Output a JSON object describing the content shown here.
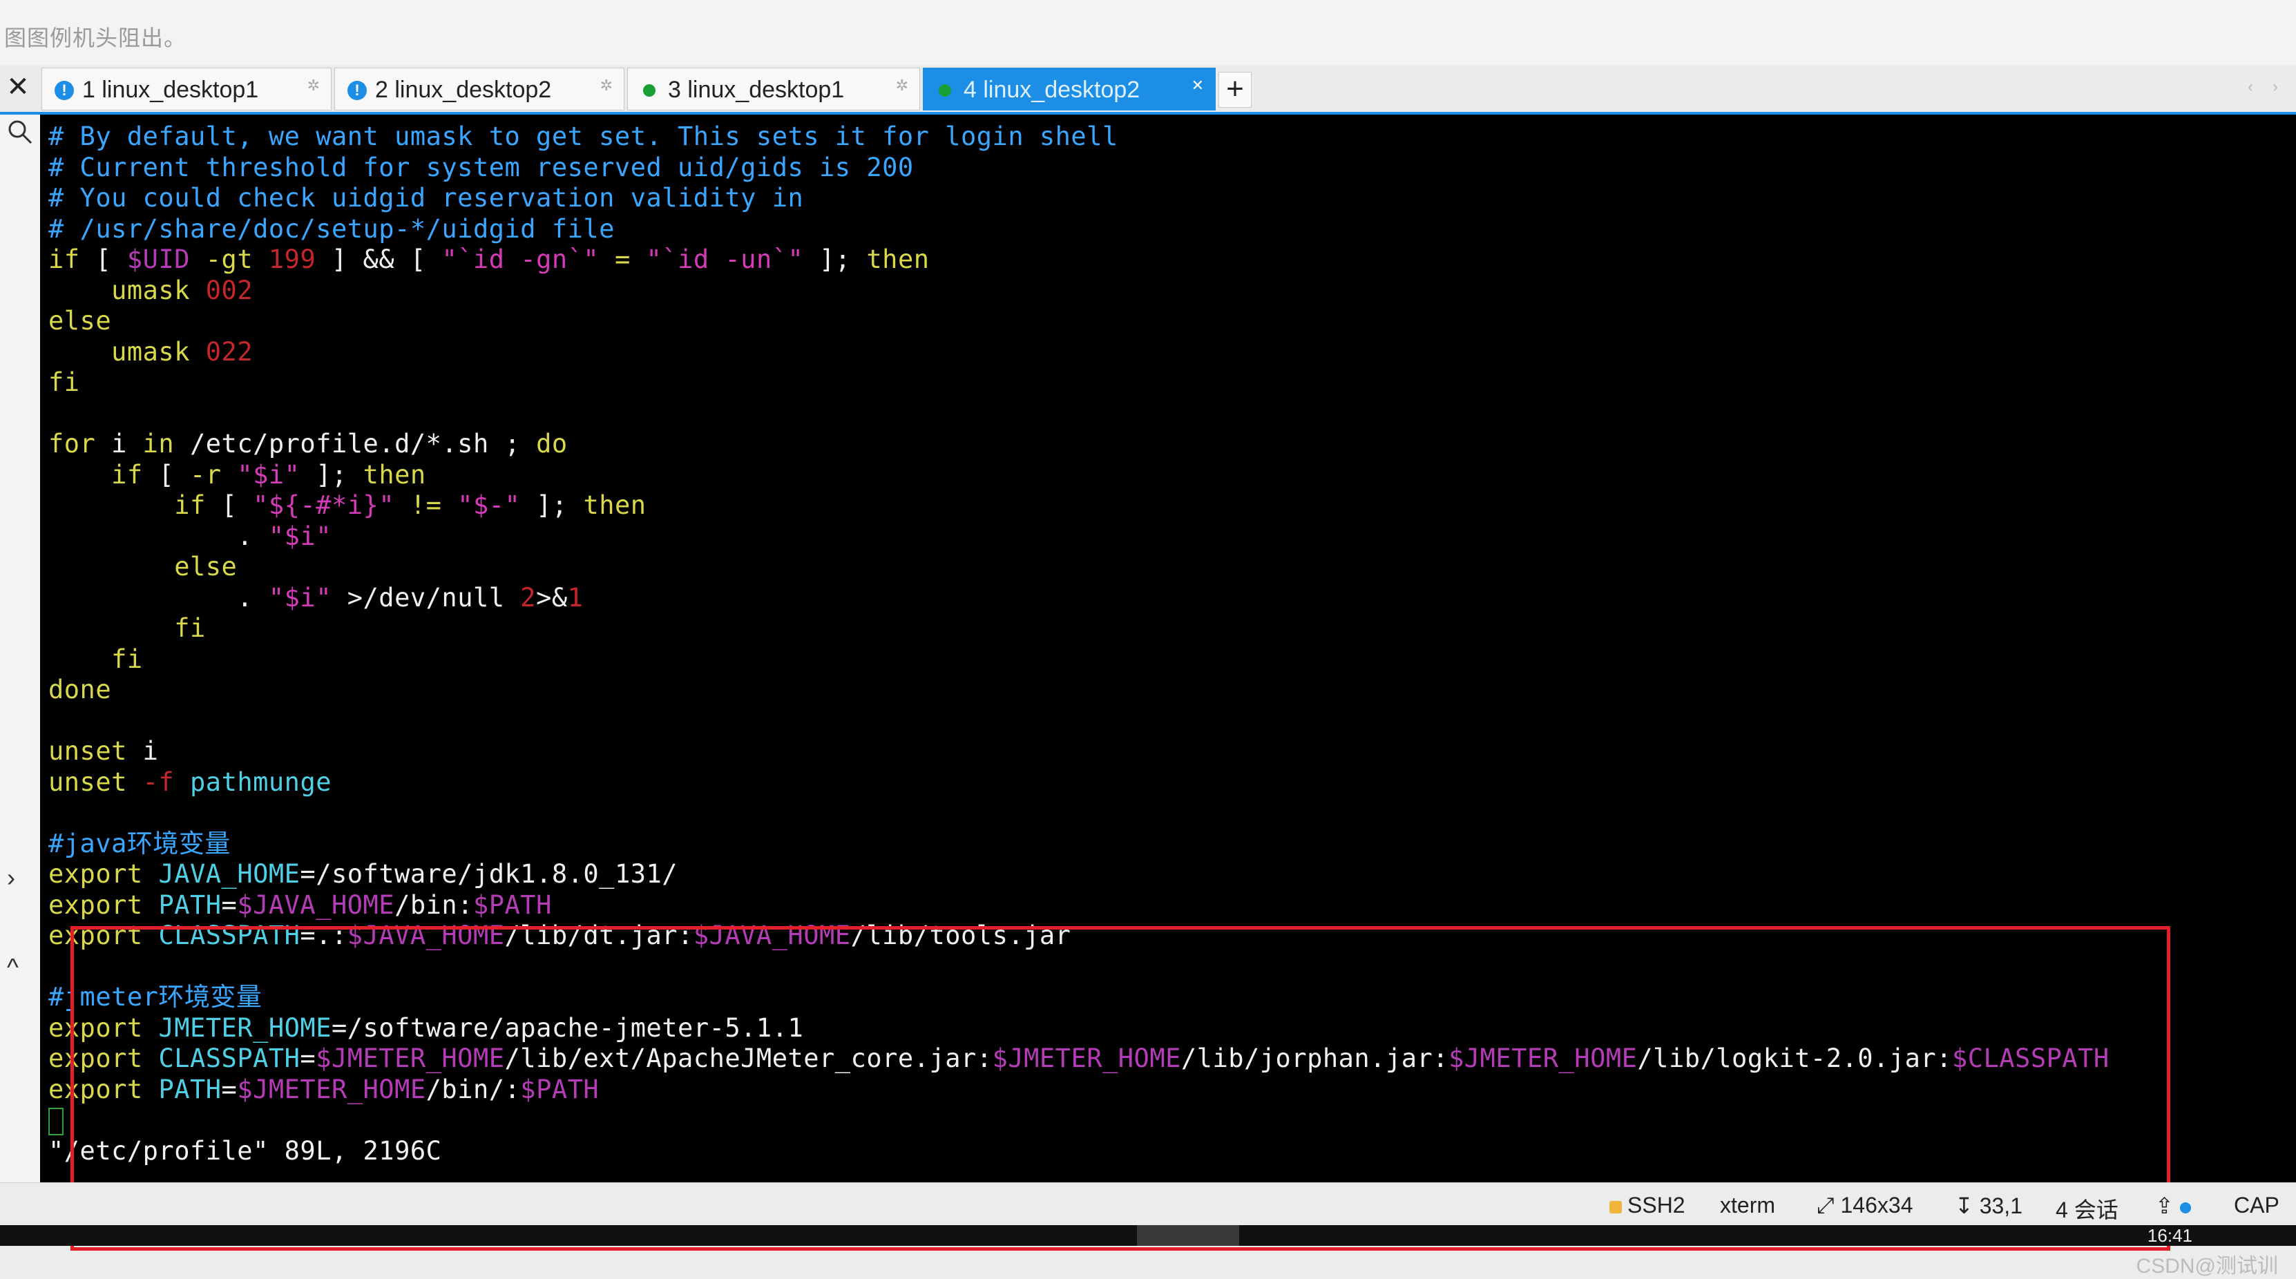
{
  "window": {
    "title": "图图例机头阻出。"
  },
  "tabs": [
    {
      "label": "1 linux_desktop1",
      "status_color": "#1d8ee6",
      "icon": "alert-icon",
      "active": false
    },
    {
      "label": "2 linux_desktop2",
      "status_color": "#1d8ee6",
      "icon": "alert-icon",
      "active": false
    },
    {
      "label": "3 linux_desktop1",
      "status_color": "#18a035",
      "icon": "connected-dot-icon",
      "active": false
    },
    {
      "label": "4 linux_desktop2",
      "status_color": "#18a035",
      "icon": "connected-dot-icon",
      "active": true
    }
  ],
  "tab_bar": {
    "close_all": "✕",
    "add": "+",
    "prev": "‹",
    "next": "›"
  },
  "left_rail": {
    "search_icon": "search-icon",
    "expand_icon": "chevron-right-icon",
    "collapse_icon": "chevron-up-icon"
  },
  "terminal": {
    "lines": [
      [
        [
          "cmt",
          "# By default, we want umask to get set. This sets it for login shell"
        ]
      ],
      [
        [
          "cmt",
          "# Current threshold for system reserved uid/gids is 200"
        ]
      ],
      [
        [
          "cmt",
          "# You could check uidgid reservation validity in"
        ]
      ],
      [
        [
          "cmt",
          "# /usr/share/doc/setup-*/uidgid file"
        ]
      ],
      [
        [
          "kw",
          "if"
        ],
        [
          "wht",
          " [ "
        ],
        [
          "var",
          "$UID"
        ],
        [
          "kw",
          " -gt "
        ],
        [
          "num",
          "199"
        ],
        [
          "wht",
          " ] && [ "
        ],
        [
          "str",
          "\"`id -gn`\""
        ],
        [
          "kw",
          " = "
        ],
        [
          "str",
          "\"`id -un`\""
        ],
        [
          "wht",
          " ]; "
        ],
        [
          "kw",
          "then"
        ]
      ],
      [
        [
          "wht",
          "    "
        ],
        [
          "kw",
          "umask"
        ],
        [
          "wht",
          " "
        ],
        [
          "num",
          "002"
        ]
      ],
      [
        [
          "kw",
          "else"
        ]
      ],
      [
        [
          "wht",
          "    "
        ],
        [
          "kw",
          "umask"
        ],
        [
          "wht",
          " "
        ],
        [
          "num",
          "022"
        ]
      ],
      [
        [
          "kw",
          "fi"
        ]
      ],
      [
        [
          "wht",
          ""
        ]
      ],
      [
        [
          "kw",
          "for"
        ],
        [
          "wht",
          " i "
        ],
        [
          "kw",
          "in"
        ],
        [
          "wht",
          " /etc/profile.d/*.sh ; "
        ],
        [
          "kw",
          "do"
        ]
      ],
      [
        [
          "wht",
          "    "
        ],
        [
          "kw",
          "if"
        ],
        [
          "wht",
          " [ "
        ],
        [
          "kw",
          "-r"
        ],
        [
          "wht",
          " "
        ],
        [
          "str",
          "\"$i\""
        ],
        [
          "wht",
          " ]; "
        ],
        [
          "kw",
          "then"
        ]
      ],
      [
        [
          "wht",
          "        "
        ],
        [
          "kw",
          "if"
        ],
        [
          "wht",
          " [ "
        ],
        [
          "str",
          "\"${-#*i}\""
        ],
        [
          "wht",
          " "
        ],
        [
          "kw",
          "!="
        ],
        [
          "wht",
          " "
        ],
        [
          "str",
          "\"$-\""
        ],
        [
          "wht",
          " ]; "
        ],
        [
          "kw",
          "then"
        ]
      ],
      [
        [
          "wht",
          "            . "
        ],
        [
          "str",
          "\"$i\""
        ]
      ],
      [
        [
          "wht",
          "        "
        ],
        [
          "kw",
          "else"
        ]
      ],
      [
        [
          "wht",
          "            . "
        ],
        [
          "str",
          "\"$i\""
        ],
        [
          "wht",
          " >/dev/null "
        ],
        [
          "num",
          "2"
        ],
        [
          "wht",
          ">&"
        ],
        [
          "num",
          "1"
        ]
      ],
      [
        [
          "wht",
          "        "
        ],
        [
          "kw",
          "fi"
        ]
      ],
      [
        [
          "wht",
          "    "
        ],
        [
          "kw",
          "fi"
        ]
      ],
      [
        [
          "kw",
          "done"
        ]
      ],
      [
        [
          "wht",
          ""
        ]
      ],
      [
        [
          "kw",
          "unset"
        ],
        [
          "wht",
          " i"
        ]
      ],
      [
        [
          "kw",
          "unset"
        ],
        [
          "wht",
          " "
        ],
        [
          "num",
          "-f"
        ],
        [
          "wht",
          " "
        ],
        [
          "cyan",
          "pathmunge"
        ]
      ],
      [
        [
          "wht",
          ""
        ]
      ],
      [
        [
          "cmt",
          "#java环境变量"
        ]
      ],
      [
        [
          "kw",
          "export"
        ],
        [
          "wht",
          " "
        ],
        [
          "cyan",
          "JAVA_HOME"
        ],
        [
          "wht",
          "=/software/jdk1.8.0_131/"
        ]
      ],
      [
        [
          "kw",
          "export"
        ],
        [
          "wht",
          " "
        ],
        [
          "cyan",
          "PATH"
        ],
        [
          "wht",
          "="
        ],
        [
          "var",
          "$JAVA_HOME"
        ],
        [
          "wht",
          "/bin:"
        ],
        [
          "var",
          "$PATH"
        ]
      ],
      [
        [
          "kw",
          "export"
        ],
        [
          "wht",
          " "
        ],
        [
          "cyan",
          "CLASSPATH"
        ],
        [
          "wht",
          "=.:"
        ],
        [
          "var",
          "$JAVA_HOME"
        ],
        [
          "wht",
          "/lib/dt.jar:"
        ],
        [
          "var",
          "$JAVA_HOME"
        ],
        [
          "wht",
          "/lib/tools.jar"
        ]
      ],
      [
        [
          "wht",
          ""
        ]
      ],
      [
        [
          "cmt",
          "#jmeter环境变量"
        ]
      ],
      [
        [
          "kw",
          "export"
        ],
        [
          "wht",
          " "
        ],
        [
          "cyan",
          "JMETER_HOME"
        ],
        [
          "wht",
          "=/software/apache-jmeter-5.1.1"
        ]
      ],
      [
        [
          "kw",
          "export"
        ],
        [
          "wht",
          " "
        ],
        [
          "cyan",
          "CLASSPATH"
        ],
        [
          "wht",
          "="
        ],
        [
          "var",
          "$JMETER_HOME"
        ],
        [
          "wht",
          "/lib/ext/ApacheJMeter_core.jar:"
        ],
        [
          "var",
          "$JMETER_HOME"
        ],
        [
          "wht",
          "/lib/jorphan.jar:"
        ],
        [
          "var",
          "$JMETER_HOME"
        ],
        [
          "wht",
          "/lib/logkit-2.0.jar:"
        ],
        [
          "var",
          "$CLASSPATH"
        ]
      ],
      [
        [
          "kw",
          "export"
        ],
        [
          "wht",
          " "
        ],
        [
          "cyan",
          "PATH"
        ],
        [
          "wht",
          "="
        ],
        [
          "var",
          "$JMETER_HOME"
        ],
        [
          "wht",
          "/bin/:"
        ],
        [
          "var",
          "$PATH"
        ]
      ],
      [
        [
          "cursor",
          ""
        ]
      ],
      [
        [
          "status-line",
          "\"/etc/profile\" 89L, 2196C"
        ]
      ]
    ],
    "watermark": "CSDN@测试训"
  },
  "statusbar": {
    "protocol": "SSH2",
    "terminal_type": "xterm",
    "size": "146x34",
    "position": "33,1",
    "sessions": "4 会话",
    "caps": "CAP"
  },
  "taskbar": {
    "clock": "16:41"
  }
}
